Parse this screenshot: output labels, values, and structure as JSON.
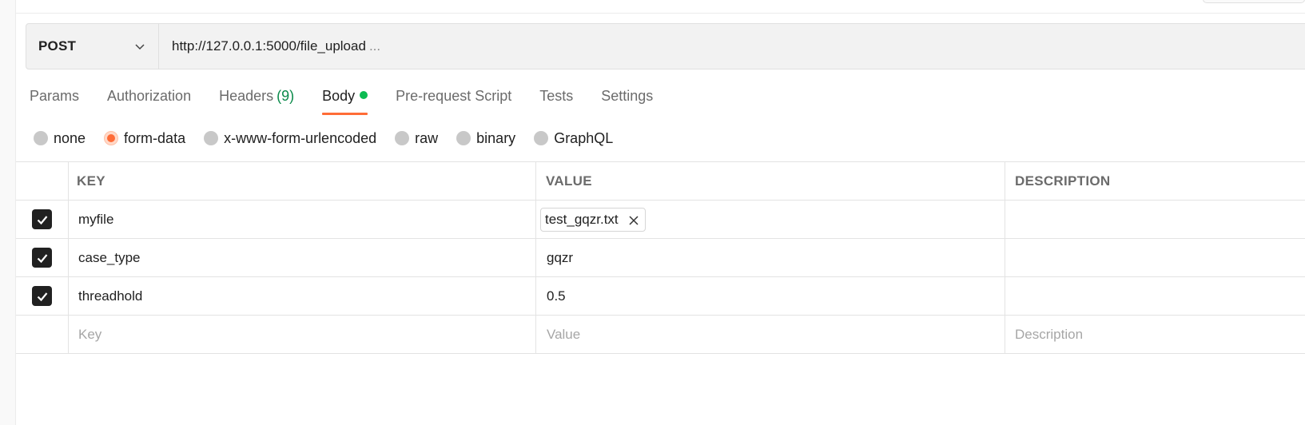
{
  "request": {
    "method": "POST",
    "url": "http://127.0.0.1:5000/file_upload",
    "url_ellipsis": "..."
  },
  "tabs": [
    {
      "label": "Params"
    },
    {
      "label": "Authorization"
    },
    {
      "label": "Headers",
      "count": "(9)"
    },
    {
      "label": "Body",
      "active": true,
      "indicator": "green-dot"
    },
    {
      "label": "Pre-request Script"
    },
    {
      "label": "Tests"
    },
    {
      "label": "Settings"
    }
  ],
  "body_types": [
    {
      "label": "none",
      "selected": false
    },
    {
      "label": "form-data",
      "selected": true
    },
    {
      "label": "x-www-form-urlencoded",
      "selected": false
    },
    {
      "label": "raw",
      "selected": false
    },
    {
      "label": "binary",
      "selected": false
    },
    {
      "label": "GraphQL",
      "selected": false
    }
  ],
  "table": {
    "headers": {
      "key": "KEY",
      "value": "VALUE",
      "description": "DESCRIPTION"
    },
    "rows": [
      {
        "checked": true,
        "key": "myfile",
        "value": "test_gqzr.txt",
        "value_type": "file",
        "description": ""
      },
      {
        "checked": true,
        "key": "case_type",
        "value": "gqzr",
        "value_type": "text",
        "description": ""
      },
      {
        "checked": true,
        "key": "threadhold",
        "value": "0.5",
        "value_type": "text",
        "description": ""
      }
    ],
    "placeholders": {
      "key": "Key",
      "value": "Value",
      "description": "Description"
    }
  },
  "colors": {
    "accent": "#ff6c37",
    "indicator_green": "#0cbb52",
    "count_green": "#0a8a4a"
  },
  "icons": {
    "method_dropdown": "chevron-down-icon",
    "file_remove": "close-icon",
    "row_check": "check-icon"
  }
}
